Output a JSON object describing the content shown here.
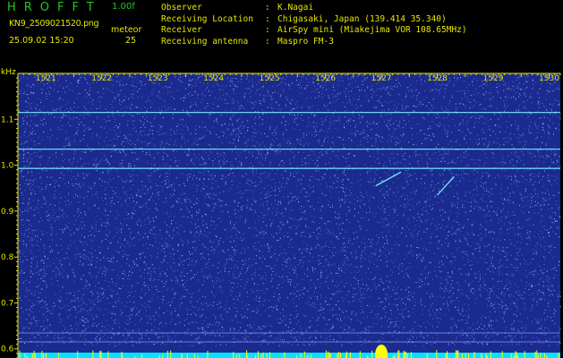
{
  "header": {
    "app_title": "HROFFT",
    "version": "1.00f",
    "file_name": "KN9_2509021520.png",
    "mode": "meteor",
    "datetime": "25.09.02 15:20",
    "count": "25",
    "info": [
      {
        "key": "Observer",
        "value": "K.Nagai"
      },
      {
        "key": "Receiving Location",
        "value": "Chigasaki, Japan (139.414 35.340)"
      },
      {
        "key": "Receiver",
        "value": "AirSpy mini (Miakejima VOR 108.65MHz)"
      },
      {
        "key": "Receiving antenna",
        "value": "Maspro FM-3"
      }
    ]
  },
  "spectrogram": {
    "y_unit": "kHz",
    "y_ticks": [
      "1.1",
      "1.0",
      "0.9",
      "0.8",
      "0.7",
      "0.6"
    ],
    "y_values": [
      1.1,
      1.0,
      0.9,
      0.8,
      0.7,
      0.6
    ],
    "y_range": [
      0.58,
      1.2
    ],
    "x_ticks": [
      "1521",
      "1522",
      "1523",
      "1524",
      "1525",
      "1526",
      "1527",
      "1528",
      "1529",
      "1530"
    ],
    "x_values": [
      1521,
      1522,
      1523,
      1524,
      1525,
      1526,
      1527,
      1528,
      1529,
      1530
    ],
    "x_range": [
      1520.5,
      1530.2
    ],
    "carrier_lines_khz": [
      1.115,
      1.035,
      0.993
    ],
    "colors": {
      "background": "#1b2a8f",
      "noise": "#7fb3ff",
      "carrier": "#7ff0ff",
      "baseline": "#00e5ff",
      "marker": "#ffff00",
      "tick": "#e6e600"
    },
    "meteor_echoes": [
      {
        "x1": 1526.9,
        "y1": 0.955,
        "x2": 1527.35,
        "y2": 0.985
      },
      {
        "x1": 1528.0,
        "y1": 0.935,
        "x2": 1528.3,
        "y2": 0.975
      }
    ]
  }
}
